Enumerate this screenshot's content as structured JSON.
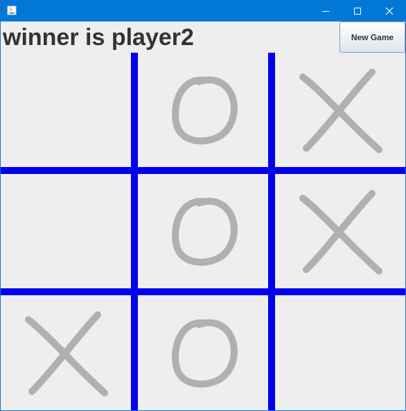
{
  "window": {
    "icon": "java-icon",
    "controls": [
      "minimize-icon",
      "maximize-icon",
      "close-icon"
    ]
  },
  "status_text": "winner is player2",
  "new_game_label": "New Game",
  "board": [
    [
      "",
      "O",
      "X"
    ],
    [
      "",
      "O",
      "X"
    ],
    [
      "X",
      "O",
      ""
    ]
  ],
  "colors": {
    "grid": "#0000ee",
    "mark": "#b0b0b0",
    "titlebar": "#0078d7",
    "background": "#eeeeee"
  }
}
